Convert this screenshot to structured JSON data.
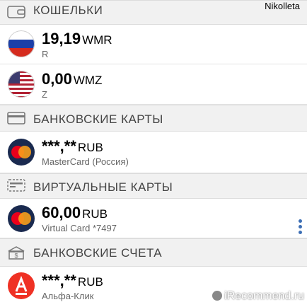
{
  "header": {
    "username": "Nikolleta"
  },
  "sections": {
    "wallets": {
      "title": "КОШЕЛЬКИ",
      "icon": "wallet-icon"
    },
    "bank_cards": {
      "title": "БАНКОВСКИЕ КАРТЫ",
      "icon": "card-icon"
    },
    "virtual_cards": {
      "title": "ВИРТУАЛЬНЫЕ КАРТЫ",
      "icon": "virtual-card-icon"
    },
    "bank_accounts": {
      "title": "БАНКОВСКИЕ СЧЕТА",
      "icon": "bank-icon"
    }
  },
  "rows": {
    "wmr": {
      "amount": "19,19",
      "currency": "WMR",
      "sub": "R",
      "icon": "russia-flag-icon"
    },
    "wmz": {
      "amount": "0,00",
      "currency": "WMZ",
      "sub": "Z",
      "icon": "usa-flag-icon"
    },
    "mastercard": {
      "amount": "***,**",
      "currency": "RUB",
      "sub": "MasterCard (Россия)",
      "icon": "mastercard-icon"
    },
    "virtual": {
      "amount": "60,00",
      "currency": "RUB",
      "sub": "Virtual Card *7497",
      "icon": "mastercard-icon"
    },
    "alfa": {
      "amount": "***,**",
      "currency": "RUB",
      "sub": "Альфа-Клик",
      "icon": "alfa-bank-icon"
    }
  },
  "watermark": {
    "text": "iRecommend.ru"
  },
  "colors": {
    "section_bg": "#f1f1f1",
    "row_bg": "#ffffff",
    "dots": "#3d6fb5",
    "alfa_red": "#ef3124"
  }
}
